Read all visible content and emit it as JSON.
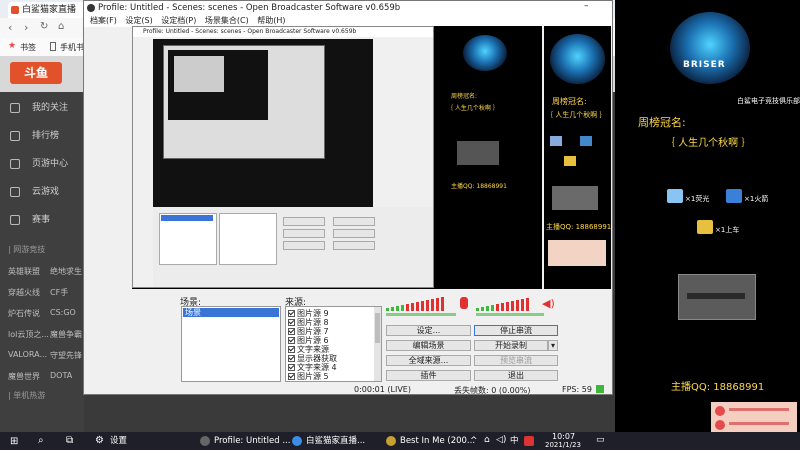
{
  "browser": {
    "tab_title": "白鲨猫家直播",
    "bookmarks_label": "书签",
    "bookmarks_item": "手机书签",
    "site_logo": "斗鱼",
    "sidebar": [
      "我的关注",
      "排行榜",
      "页游中心",
      "云游戏",
      "赛事"
    ],
    "section_label": "| 网游竞技",
    "sub_rows": [
      [
        "英雄联盟",
        "绝地求生"
      ],
      [
        "穿越火线",
        "CF手"
      ],
      [
        "炉石传说",
        "CS:GO"
      ],
      [
        "lol云顶之...",
        "魔兽争霸"
      ],
      [
        "VALORA...",
        "守望先锋"
      ],
      [
        "魔兽世界",
        "DOTA"
      ]
    ],
    "section2_label": "| 单机热游"
  },
  "obs": {
    "window_title": "Profile: Untitled - Scenes: scenes - Open Broadcaster Software v0.659b",
    "menu": [
      "档案(F)",
      "设定(S)",
      "设定档(P)",
      "场景集合(C)",
      "帮助(H)"
    ],
    "scenes_label": "场景:",
    "sources_label": "来源:",
    "selected_scene": "场景",
    "sources": [
      "图片源 9",
      "图片源 8",
      "图片源 7",
      "图片源 6",
      "文字来源",
      "显示器获取",
      "文字来源 4",
      "图片源 5"
    ],
    "buttons": {
      "settings": "设定...",
      "stop_stream": "停止串流",
      "edit_scene": "编辑场景",
      "start_record": "开始录制",
      "global_sources": "全域来源...",
      "preview_stream": "预览串流",
      "plugins": "插件",
      "exit": "退出"
    },
    "status": {
      "time": "0:00:01 (LIVE)",
      "dropped": "丢失帧数: 0 (0.00%)",
      "fps": "FPS: 59"
    }
  },
  "stream_overlay": {
    "brand": "白鲨电子竞技俱乐部",
    "weekly_title": "周榜冠名:",
    "weekly_name": "｛ 人生几个秋啊 ｝",
    "gift1": "×1荧光",
    "gift2": "×1火箭",
    "gift3": "×1上车",
    "qq_label": "主播QQ: 18868991",
    "mini_logo_text": "BRISER"
  },
  "taskbar": {
    "search_label": "设置",
    "item1": "Profile: Untitled ...",
    "item2": "白鲨猫家直播...",
    "item3": "Best In Me (200...",
    "lang": "中",
    "time": "10:07",
    "date": "2021/1/23"
  },
  "colors": {
    "stop_red": "#ff2d2d",
    "accent_blue": "#3875d7",
    "douyu_orange": "#e2522a",
    "meter_green": "#3db83d",
    "meter_red": "#e03030"
  }
}
